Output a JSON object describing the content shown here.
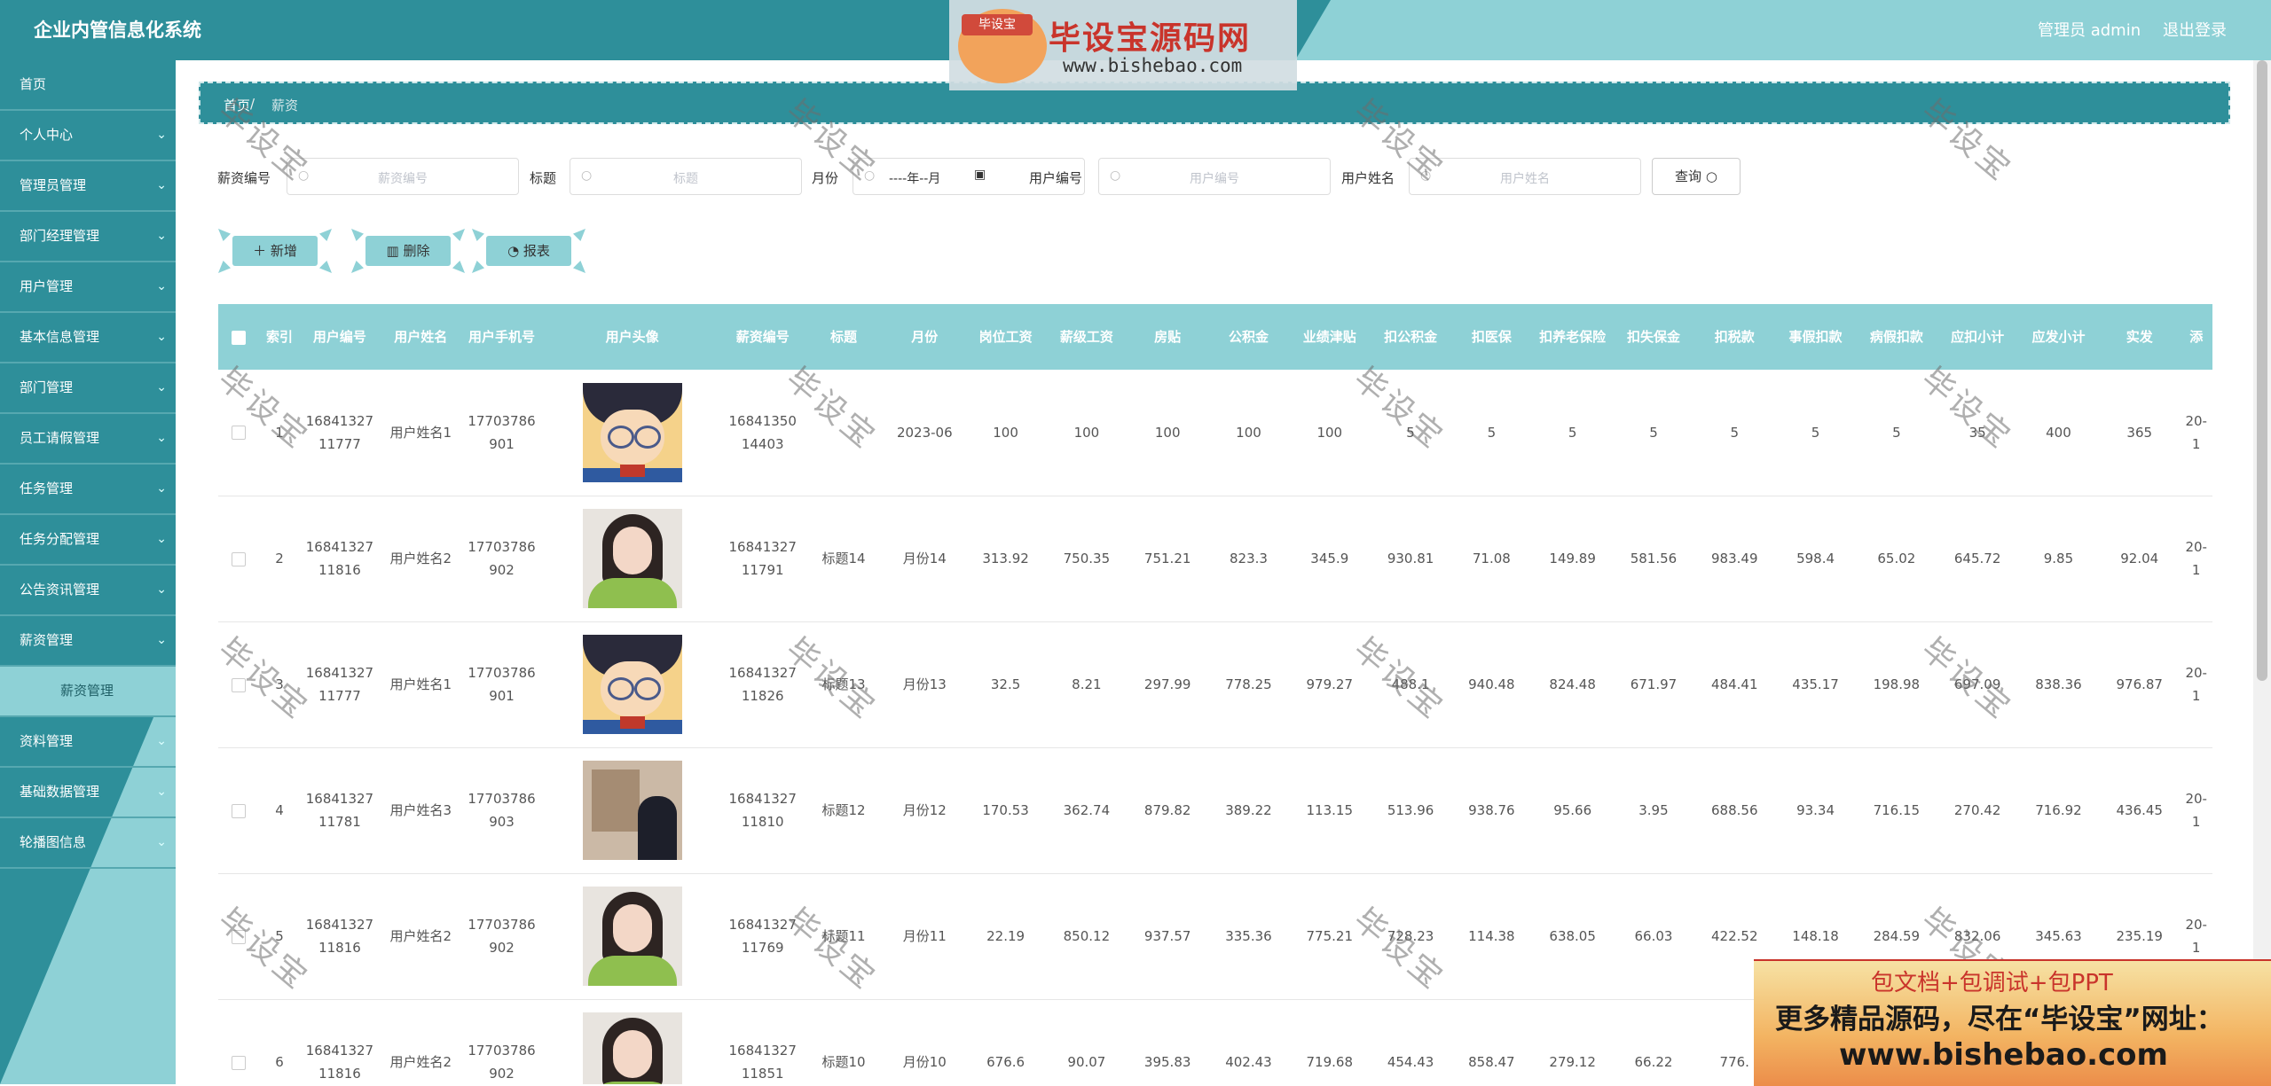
{
  "header": {
    "title": "企业内管信息化系统",
    "admin": "管理员 admin",
    "logout": "退出登录"
  },
  "logo": {
    "tag": "毕设宝",
    "title": "毕设宝源码网",
    "url": "www.bishebao.com"
  },
  "sidebar": {
    "items": [
      {
        "label": "首页",
        "chevron": false
      },
      {
        "label": "个人中心",
        "chevron": true
      },
      {
        "label": "管理员管理",
        "chevron": true
      },
      {
        "label": "部门经理管理",
        "chevron": true
      },
      {
        "label": "用户管理",
        "chevron": true
      },
      {
        "label": "基本信息管理",
        "chevron": true
      },
      {
        "label": "部门管理",
        "chevron": true
      },
      {
        "label": "员工请假管理",
        "chevron": true
      },
      {
        "label": "任务管理",
        "chevron": true
      },
      {
        "label": "任务分配管理",
        "chevron": true
      },
      {
        "label": "公告资讯管理",
        "chevron": true
      },
      {
        "label": "薪资管理",
        "chevron": true
      },
      {
        "label": "薪资管理",
        "chevron": false,
        "sub": true
      },
      {
        "label": "资料管理",
        "chevron": true
      },
      {
        "label": "基础数据管理",
        "chevron": true
      },
      {
        "label": "轮播图信息",
        "chevron": true
      }
    ]
  },
  "breadcrumb": {
    "home": "首页",
    "sep": "/",
    "current": "薪资"
  },
  "filters": [
    {
      "label": "薪资编号",
      "placeholder": "薪资编号"
    },
    {
      "label": "标题",
      "placeholder": "标题"
    },
    {
      "label": "月份",
      "placeholder": "----年--月"
    },
    {
      "label": "用户编号",
      "placeholder": "用户编号"
    },
    {
      "label": "用户姓名",
      "placeholder": "用户姓名"
    }
  ],
  "query_label": "查询",
  "actions": {
    "add": "新增",
    "delete": "删除",
    "report": "报表"
  },
  "table": {
    "columns": [
      "索引",
      "用户编号",
      "用户姓名",
      "用户手机号",
      "用户头像",
      "薪资编号",
      "标题",
      "月份",
      "岗位工资",
      "薪级工资",
      "房贴",
      "公积金",
      "业绩津贴",
      "扣公积金",
      "扣医保",
      "扣养老保险",
      "扣失保金",
      "扣税款",
      "事假扣款",
      "病假扣款",
      "应扣小计",
      "应发小计",
      "实发",
      "添"
    ],
    "rows": [
      [
        "1",
        "1684132711777",
        "用户姓名1",
        "17703786901",
        "conan",
        "1684135014403",
        "",
        "2023-06",
        "100",
        "100",
        "100",
        "100",
        "100",
        "5",
        "5",
        "5",
        "5",
        "5",
        "5",
        "5",
        "35",
        "400",
        "365",
        "20-1"
      ],
      [
        "2",
        "1684132711816",
        "用户姓名2",
        "17703786902",
        "girl",
        "1684132711791",
        "标题14",
        "月份14",
        "313.92",
        "750.35",
        "751.21",
        "823.3",
        "345.9",
        "930.81",
        "71.08",
        "149.89",
        "581.56",
        "983.49",
        "598.4",
        "65.02",
        "645.72",
        "9.85",
        "92.04",
        "20-1"
      ],
      [
        "3",
        "1684132711777",
        "用户姓名1",
        "17703786901",
        "conan",
        "1684132711826",
        "标题13",
        "月份13",
        "32.5",
        "8.21",
        "297.99",
        "778.25",
        "979.27",
        "488.1",
        "940.48",
        "824.48",
        "671.97",
        "484.41",
        "435.17",
        "198.98",
        "697.09",
        "838.36",
        "976.87",
        "20-1"
      ],
      [
        "4",
        "1684132711781",
        "用户姓名3",
        "17703786903",
        "room",
        "1684132711810",
        "标题12",
        "月份12",
        "170.53",
        "362.74",
        "879.82",
        "389.22",
        "113.15",
        "513.96",
        "938.76",
        "95.66",
        "3.95",
        "688.56",
        "93.34",
        "716.15",
        "270.42",
        "716.92",
        "436.45",
        "20-1"
      ],
      [
        "5",
        "1684132711816",
        "用户姓名2",
        "17703786902",
        "girl",
        "1684132711769",
        "标题11",
        "月份11",
        "22.19",
        "850.12",
        "937.57",
        "335.36",
        "775.21",
        "728.23",
        "114.38",
        "638.05",
        "66.03",
        "422.52",
        "148.18",
        "284.59",
        "832.06",
        "345.63",
        "235.19",
        "20-1"
      ],
      [
        "6",
        "1684132711816",
        "用户姓名2",
        "17703786902",
        "girl",
        "1684132711851",
        "标题10",
        "月份10",
        "676.6",
        "90.07",
        "395.83",
        "402.43",
        "719.68",
        "454.43",
        "858.47",
        "279.12",
        "66.22",
        "776.",
        "",
        "",
        "",
        "",
        "",
        ""
      ]
    ]
  },
  "watermark": "毕设宝",
  "promo": {
    "line1": "包文档+包调试+包PPT",
    "line2": "更多精品源码，尽在“毕设宝”网址：",
    "line3": "www.bishebao.com"
  }
}
